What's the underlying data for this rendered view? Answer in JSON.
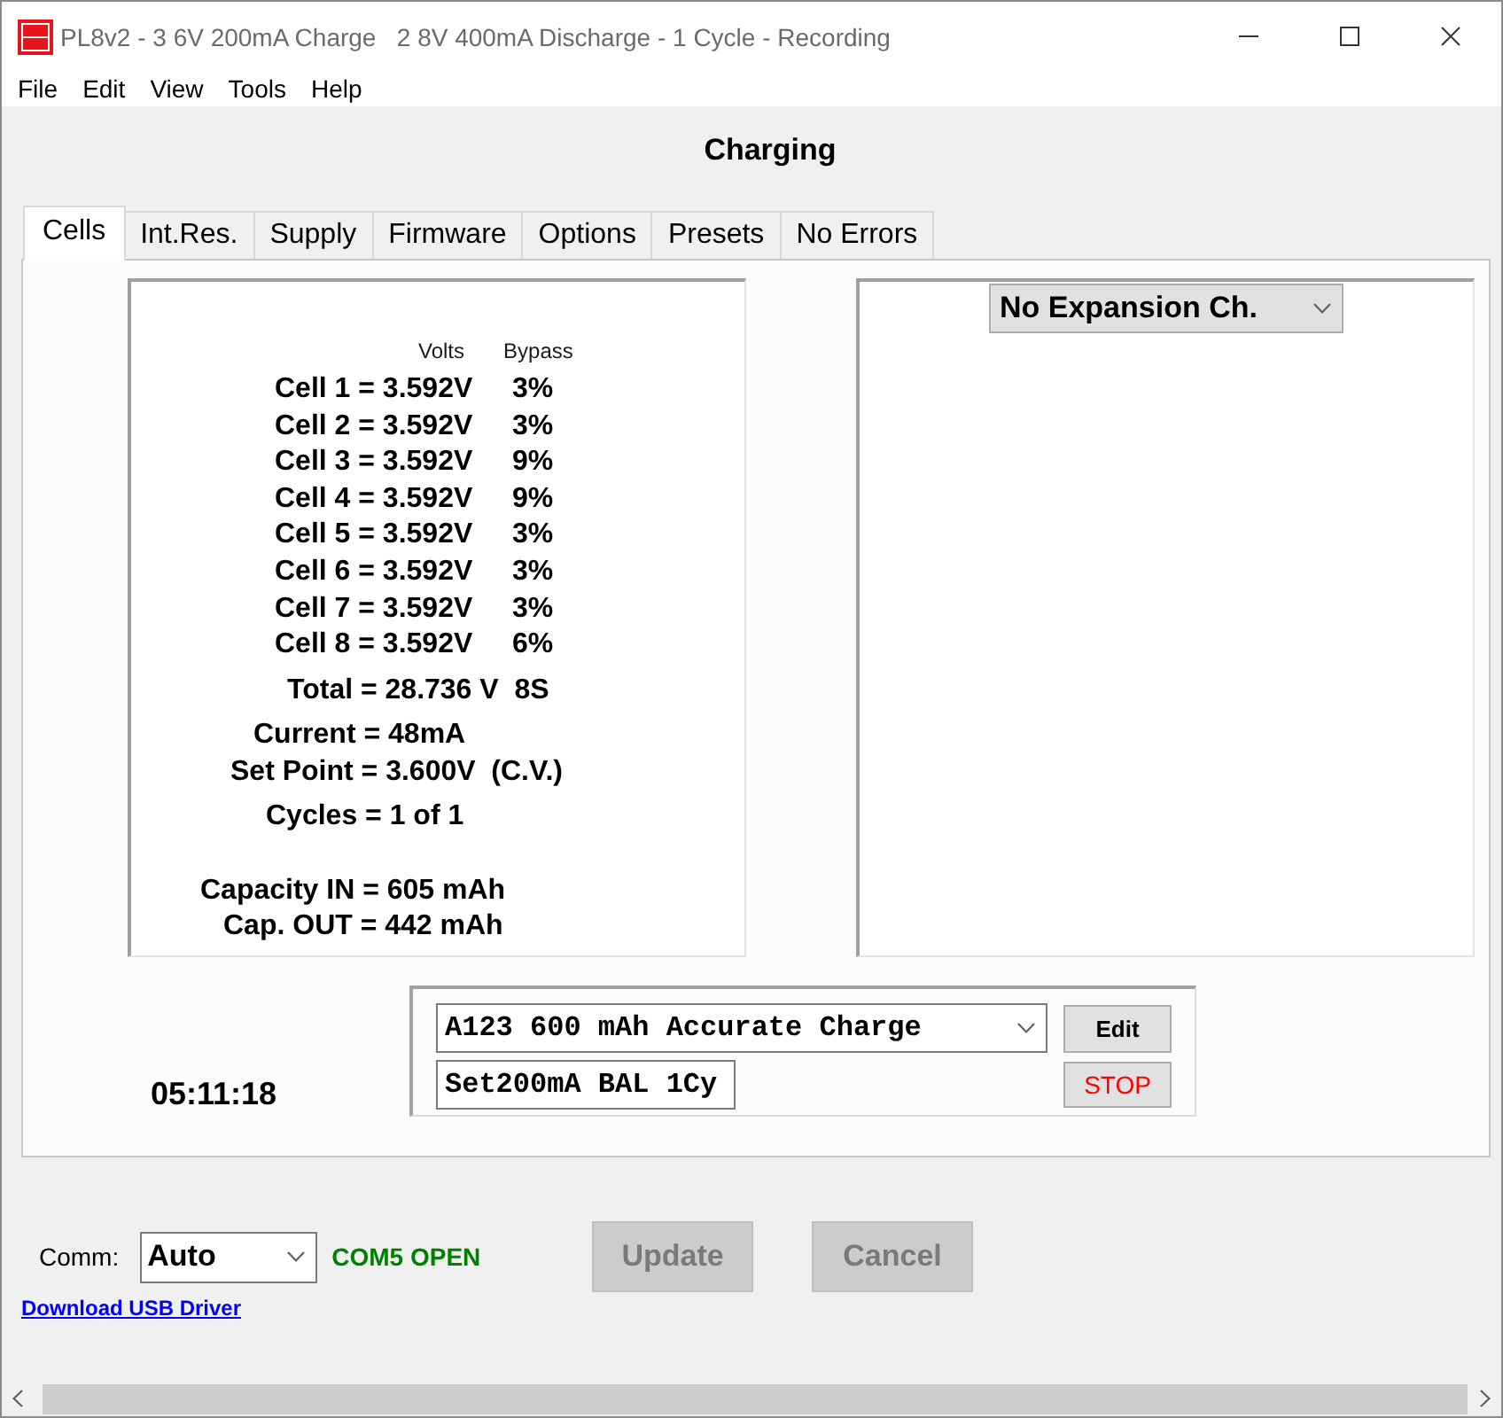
{
  "window": {
    "title": "PL8v2 - 3 6V 200mA Charge   2 8V 400mA Discharge - 1 Cycle - Recording"
  },
  "menu": [
    "File",
    "Edit",
    "View",
    "Tools",
    "Help"
  ],
  "heading": "Charging",
  "tabs": [
    {
      "label": "Cells",
      "selected": true
    },
    {
      "label": "Int.Res.",
      "selected": false
    },
    {
      "label": "Supply",
      "selected": false
    },
    {
      "label": "Firmware",
      "selected": false
    },
    {
      "label": "Options",
      "selected": false
    },
    {
      "label": "Presets",
      "selected": false
    },
    {
      "label": "No Errors",
      "selected": false
    }
  ],
  "cells_panel": {
    "headers": [
      "Volts",
      "Bypass"
    ],
    "cells": [
      {
        "reading": "Cell 1 = 3.592V",
        "bypass": "3%"
      },
      {
        "reading": "Cell 2 = 3.592V",
        "bypass": "3%"
      },
      {
        "reading": "Cell 3 = 3.592V",
        "bypass": "9%"
      },
      {
        "reading": "Cell 4 = 3.592V",
        "bypass": "9%"
      },
      {
        "reading": "Cell 5 = 3.592V",
        "bypass": "3%"
      },
      {
        "reading": "Cell 6 = 3.592V",
        "bypass": "3%"
      },
      {
        "reading": "Cell 7 = 3.592V",
        "bypass": "3%"
      },
      {
        "reading": "Cell 8 = 3.592V",
        "bypass": "6%"
      }
    ],
    "readouts": [
      "Total = 28.736 V  8S",
      "Current = 48mA",
      "Set Point = 3.600V  (C.V.)",
      "Cycles = 1 of 1",
      "Capacity IN = 605 mAh",
      "Cap. OUT = 442 mAh"
    ]
  },
  "expansion": {
    "value": "No Expansion Ch."
  },
  "timer": "05:11:18",
  "program": {
    "preset": "A123 600 mAh Accurate Charge",
    "name": "Set200mA BAL 1Cy",
    "buttons": [
      {
        "label": "Edit",
        "kind": "edit"
      },
      {
        "label": "STOP",
        "kind": "stop"
      }
    ]
  },
  "comm": {
    "label": "Comm:",
    "value": "Auto",
    "status": "COM5 OPEN",
    "connected": true
  },
  "actions": [
    {
      "label": "Update",
      "disabled": true
    },
    {
      "label": "Cancel",
      "disabled": true
    }
  ],
  "link": "Download USB Driver"
}
